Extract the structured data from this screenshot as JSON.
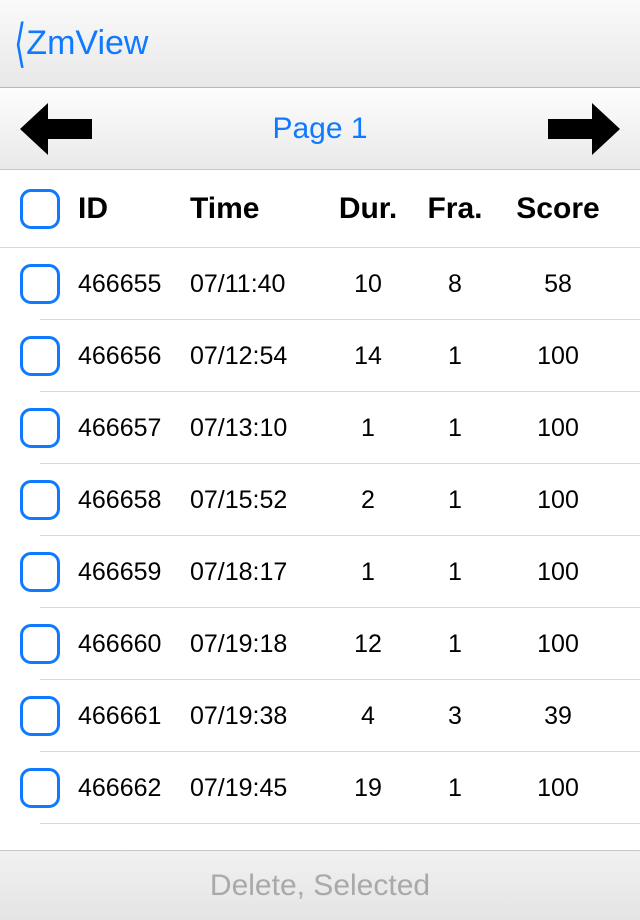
{
  "nav": {
    "back_title": "ZmView"
  },
  "pager": {
    "label": "Page 1"
  },
  "columns": {
    "id": "ID",
    "time": "Time",
    "dur": "Dur.",
    "fra": "Fra.",
    "score": "Score"
  },
  "rows": [
    {
      "id": "466655",
      "time": "07/11:40",
      "dur": "10",
      "fra": "8",
      "score": "58"
    },
    {
      "id": "466656",
      "time": "07/12:54",
      "dur": "14",
      "fra": "1",
      "score": "100"
    },
    {
      "id": "466657",
      "time": "07/13:10",
      "dur": "1",
      "fra": "1",
      "score": "100"
    },
    {
      "id": "466658",
      "time": "07/15:52",
      "dur": "2",
      "fra": "1",
      "score": "100"
    },
    {
      "id": "466659",
      "time": "07/18:17",
      "dur": "1",
      "fra": "1",
      "score": "100"
    },
    {
      "id": "466660",
      "time": "07/19:18",
      "dur": "12",
      "fra": "1",
      "score": "100"
    },
    {
      "id": "466661",
      "time": "07/19:38",
      "dur": "4",
      "fra": "3",
      "score": "39"
    },
    {
      "id": "466662",
      "time": "07/19:45",
      "dur": "19",
      "fra": "1",
      "score": "100"
    }
  ],
  "footer": {
    "delete_label": "Delete, Selected"
  }
}
